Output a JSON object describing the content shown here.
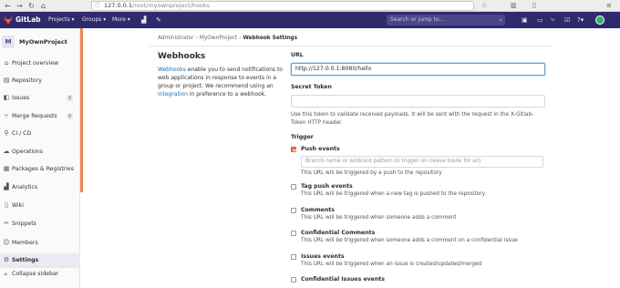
{
  "browser": {
    "url_host": "127.0.0.1",
    "url_path": "/root/myownproject/hooks",
    "menu_icon": "hamburger-icon"
  },
  "header": {
    "brand": "GitLab",
    "menu": [
      "Projects ▾",
      "Groups ▾",
      "More ▾"
    ],
    "search_placeholder": "Search or jump to...",
    "accent": "#2f2a6b"
  },
  "sidebar": {
    "project_initial": "M",
    "project_name": "MyOwnProject",
    "items": [
      {
        "label": "Project overview",
        "icon": "home-icon"
      },
      {
        "label": "Repository",
        "icon": "book-icon"
      },
      {
        "label": "Issues",
        "icon": "issues-icon",
        "badge": "0"
      },
      {
        "label": "Merge Requests",
        "icon": "merge-icon",
        "badge": "0"
      },
      {
        "label": "CI / CD",
        "icon": "rocket-icon"
      },
      {
        "label": "Operations",
        "icon": "cloud-icon"
      },
      {
        "label": "Packages & Registries",
        "icon": "package-icon"
      },
      {
        "label": "Analytics",
        "icon": "chart-icon"
      },
      {
        "label": "Wiki",
        "icon": "wiki-icon"
      },
      {
        "label": "Snippets",
        "icon": "scissors-icon"
      },
      {
        "label": "Members",
        "icon": "users-icon"
      },
      {
        "label": "Settings",
        "icon": "gear-icon",
        "active": true
      }
    ],
    "collapse_label": "Collapse sidebar",
    "accent": "#ee8a52"
  },
  "breadcrumb": {
    "items": [
      "Administrator",
      "MyOwnProject",
      "Webhook Settings"
    ]
  },
  "intro": {
    "title": "Webhooks",
    "link1": "Webhooks",
    "text1": " enable you to send notifications to web applications in response to events in a group or project. We recommend using an ",
    "link2": "integration",
    "text2": " in preference to a webhook."
  },
  "form": {
    "url_label": "URL",
    "url_value": "http://127.0.0.1:8080/hello",
    "token_label": "Secret Token",
    "token_help": "Use this token to validate received payloads. It will be sent with the request in the X-Gitlab-Token HTTP header.",
    "trigger_label": "Trigger",
    "branch_placeholder": "Branch name or wildcard pattern to trigger on (leave blank for all)",
    "triggers": [
      {
        "name": "Push events",
        "desc": "This URL will be triggered by a push to the repository",
        "checked": true
      },
      {
        "name": "Tag push events",
        "desc": "This URL will be triggered when a new tag is pushed to the repository",
        "checked": false
      },
      {
        "name": "Comments",
        "desc": "This URL will be triggered when someone adds a comment",
        "checked": false
      },
      {
        "name": "Confidential Comments",
        "desc": "This URL will be triggered when someone adds a comment on a confidential issue",
        "checked": false
      },
      {
        "name": "Issues events",
        "desc": "This URL will be triggered when an issue is created/updated/merged",
        "checked": false
      },
      {
        "name": "Confidential Issues events",
        "desc": "",
        "checked": false
      }
    ]
  }
}
